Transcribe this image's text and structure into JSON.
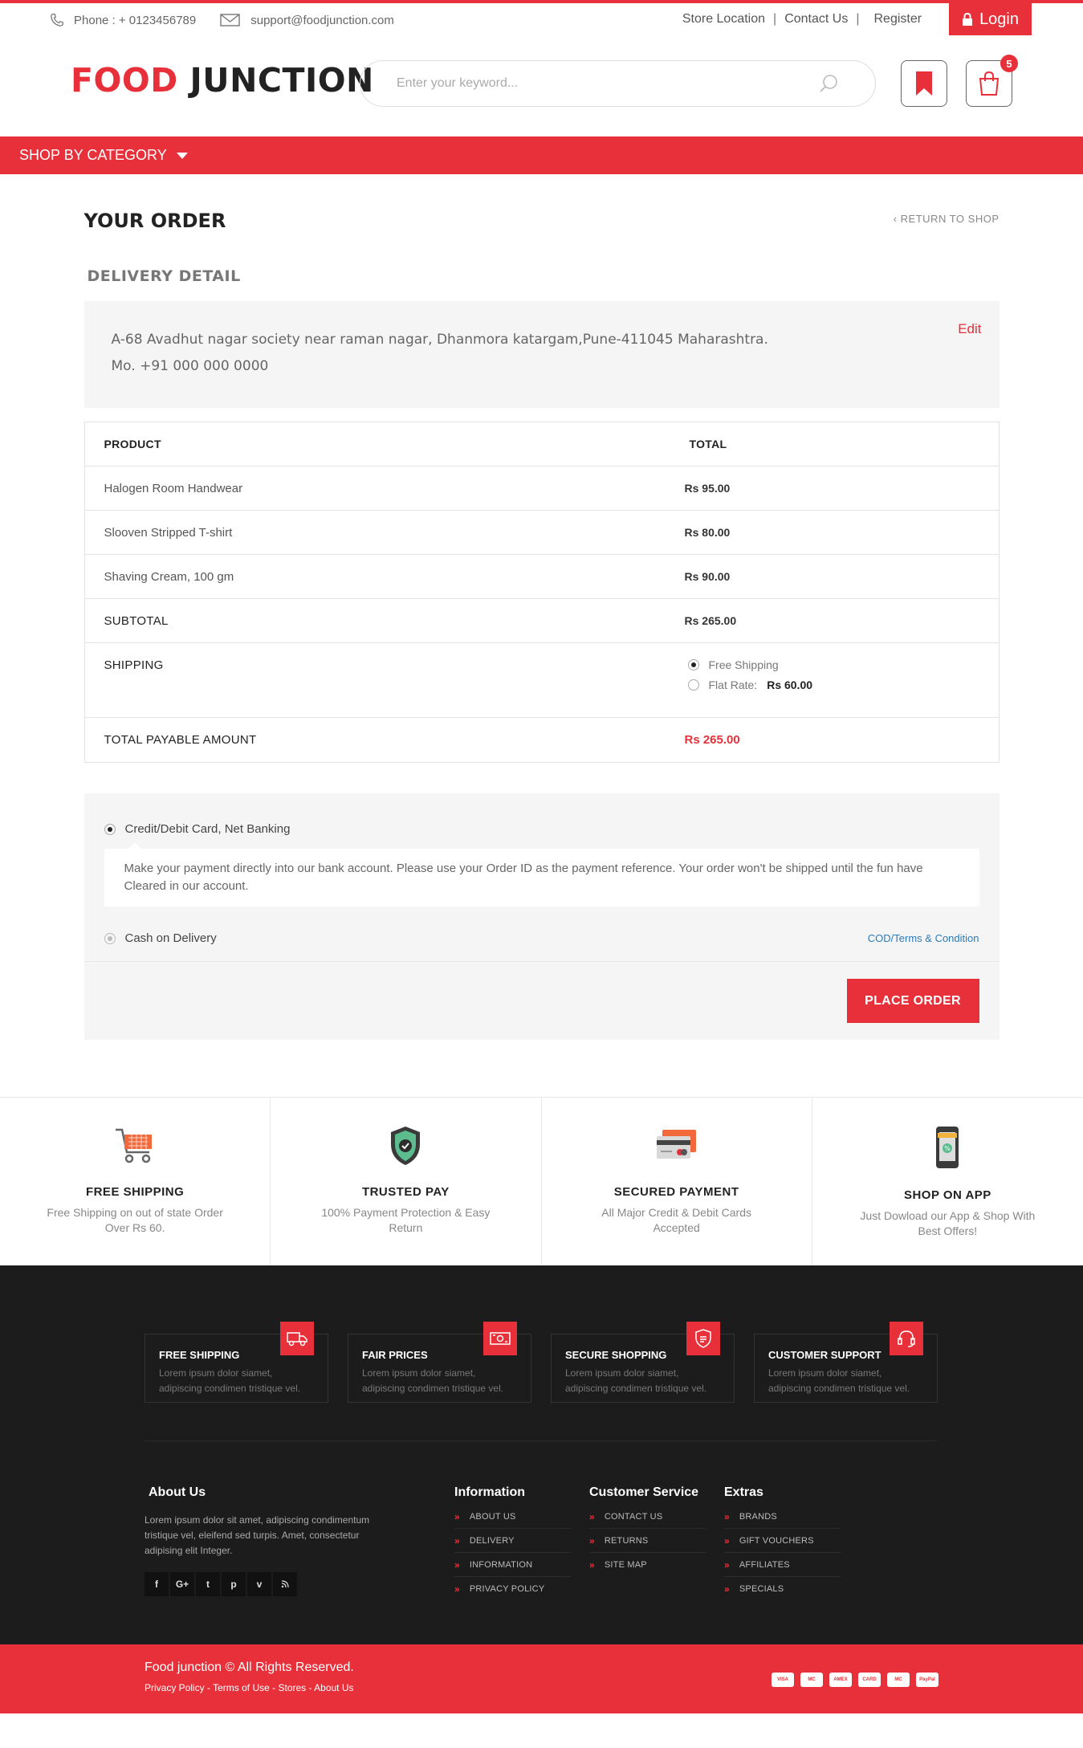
{
  "topbar": {
    "phone": "Phone : + 0123456789",
    "email": "support@foodjunction.com",
    "links": [
      "Store Location",
      "Contact Us",
      "Register"
    ],
    "separators": [
      "|",
      "|"
    ],
    "login": "Login"
  },
  "header": {
    "logo_part1": "FOOD",
    "logo_part2": "JUNCTION",
    "search_placeholder": "Enter your keyword...",
    "cart_count": "5"
  },
  "nav": {
    "category": "SHOP BY CATEGORY"
  },
  "order": {
    "title": "YOUR ORDER",
    "return_link": "RETURN TO SHOP",
    "delivery_title": "DELIVERY DETAIL",
    "address": "A-68 Avadhut nagar society near raman nagar, Dhanmora katargam,Pune-411045 Maharashtra.",
    "mobile": "Mo. +91 000 000 0000",
    "edit": "Edit"
  },
  "table": {
    "col_product": "PRODUCT",
    "col_total": "TOTAL",
    "items": [
      {
        "name": "Halogen Room Handwear",
        "price": "Rs 95.00"
      },
      {
        "name": "Slooven Stripped T-shirt",
        "price": "Rs 80.00"
      },
      {
        "name": "Shaving Cream, 100 gm",
        "price": "Rs 90.00"
      }
    ],
    "subtotal_label": "SUBTOTAL",
    "subtotal": "Rs 265.00",
    "shipping_label": "SHIPPING",
    "shipping_free": "Free Shipping",
    "shipping_flat": "Flat Rate:",
    "shipping_flat_amount": "Rs 60.00",
    "total_label": "TOTAL PAYABLE AMOUNT",
    "total": "Rs 265.00"
  },
  "payment": {
    "option1": "Credit/Debit Card, Net Banking",
    "description": "Make your payment directly into our bank account. Please use your Order ID as the payment reference. Your order won't be shipped until the fun have Cleared in our account.",
    "option2": "Cash on Delivery",
    "terms": "COD/Terms & Condition",
    "place_order": "PLACE ORDER"
  },
  "features": [
    {
      "title": "FREE SHIPPING",
      "desc": "Free Shipping on out of state Order Over Rs 60.",
      "icon": "cart-icon"
    },
    {
      "title": "TRUSTED PAY",
      "desc": "100% Payment Protection & Easy Return",
      "icon": "shield-icon"
    },
    {
      "title": "SECURED PAYMENT",
      "desc": "All Major Credit & Debit Cards Accepted",
      "icon": "credit-card-icon"
    },
    {
      "title": "SHOP ON APP",
      "desc": "Just Dowload our App & Shop With Best Offers!",
      "icon": "mobile-icon"
    }
  ],
  "footer_boxes": [
    {
      "title": "FREE SHIPPING",
      "desc": "Lorem ipsum dolor siamet, adipiscing condimen tristique vel.",
      "icon": "truck-icon"
    },
    {
      "title": "FAIR PRICES",
      "desc": "Lorem ipsum dolor siamet, adipiscing condimen tristique vel.",
      "icon": "money-icon"
    },
    {
      "title": "SECURE SHOPPING",
      "desc": "Lorem ipsum dolor siamet, adipiscing condimen tristique vel.",
      "icon": "shield-icon"
    },
    {
      "title": "CUSTOMER SUPPORT",
      "desc": "Lorem ipsum dolor siamet, adipiscing condimen tristique vel.",
      "icon": "headset-icon"
    }
  ],
  "about": {
    "title": "About Us",
    "text": "Lorem ipsum dolor sit amet, adipiscing condimentum tristique vel, eleifend sed turpis. Amet, consectetur adipising elit Integer.",
    "socials": [
      "f",
      "G+",
      "t",
      "p",
      "v",
      "rss"
    ]
  },
  "footer_cols": [
    {
      "title": "Information",
      "items": [
        "ABOUT US",
        "DELIVERY",
        "INFORMATION",
        "PRIVACY POLICY"
      ]
    },
    {
      "title": "Customer Service",
      "items": [
        "CONTACT US",
        "RETURNS",
        "SITE MAP"
      ]
    },
    {
      "title": "Extras",
      "items": [
        "BRANDS",
        "GIFT VOUCHERS",
        "AFFILIATES",
        "SPECIALS"
      ]
    }
  ],
  "copyright": {
    "text": "Food junction © All Rights Reserved.",
    "links": "Privacy Policy - Terms of Use - Stores - About Us",
    "cards": [
      "VISA",
      "MC",
      "AMEX",
      "CARD",
      "MC",
      "PayPal"
    ]
  },
  "colors": {
    "accent": "#e8303a",
    "footer_bg": "#1c1c1c",
    "link_blue": "#2a7ab8"
  }
}
